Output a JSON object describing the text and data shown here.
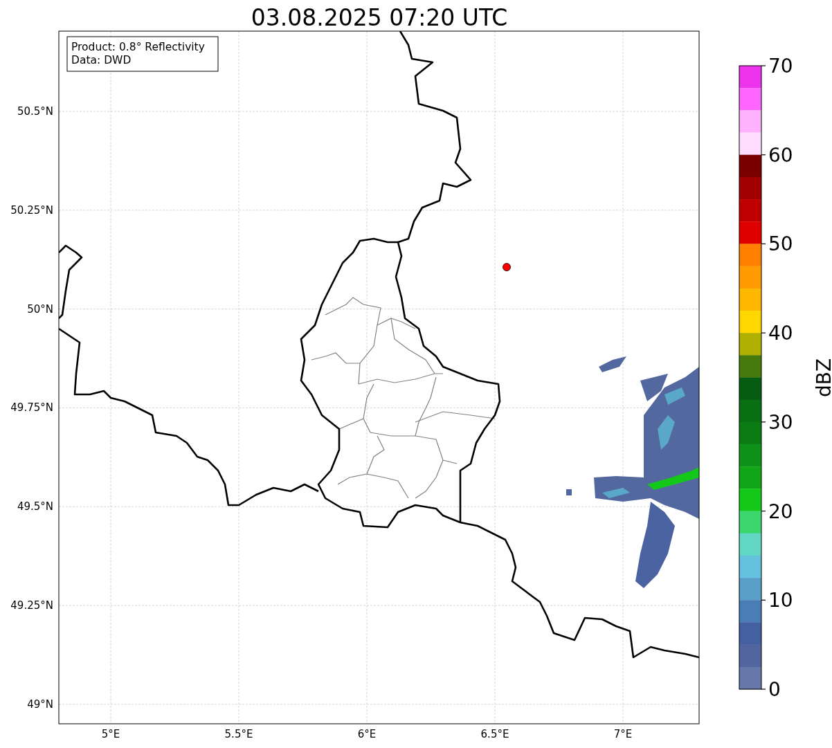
{
  "title": "03.08.2025 07:20 UTC",
  "legend": [
    "Product: 0.8° Reflectivity",
    "Data: DWD"
  ],
  "map": {
    "x_ticks": [
      "5°E",
      "5.5°E",
      "6°E",
      "6.5°E",
      "7°E"
    ],
    "y_ticks": [
      "50.5°N",
      "50.25°N",
      "50°N",
      "49.75°N",
      "49.5°N",
      "49.25°N",
      "49°N"
    ]
  },
  "colorbar": {
    "label": "dBZ",
    "ticks": [
      "70",
      "60",
      "50",
      "40",
      "30",
      "20",
      "10",
      "0"
    ],
    "bins": [
      {
        "color": "#ee33ee"
      },
      {
        "color": "#ff66ff"
      },
      {
        "color": "#ffb3ff"
      },
      {
        "color": "#ffddff"
      },
      {
        "color": "#7a0000"
      },
      {
        "color": "#a00000"
      },
      {
        "color": "#c00000"
      },
      {
        "color": "#e00000"
      },
      {
        "color": "#ff7f00"
      },
      {
        "color": "#ff9a00"
      },
      {
        "color": "#ffb800"
      },
      {
        "color": "#ffd700"
      },
      {
        "color": "#b0b000"
      },
      {
        "color": "#477a0c"
      },
      {
        "color": "#065c10"
      },
      {
        "color": "#0a6e12"
      },
      {
        "color": "#0b7b14"
      },
      {
        "color": "#0d9118"
      },
      {
        "color": "#10a618"
      },
      {
        "color": "#14c81a"
      },
      {
        "color": "#3cd66e"
      },
      {
        "color": "#62d8c4"
      },
      {
        "color": "#63c1dd"
      },
      {
        "color": "#5a9fc8"
      },
      {
        "color": "#4a7db5"
      },
      {
        "color": "#4460a0"
      },
      {
        "color": "#52659e"
      },
      {
        "color": "#6677aa"
      }
    ]
  }
}
